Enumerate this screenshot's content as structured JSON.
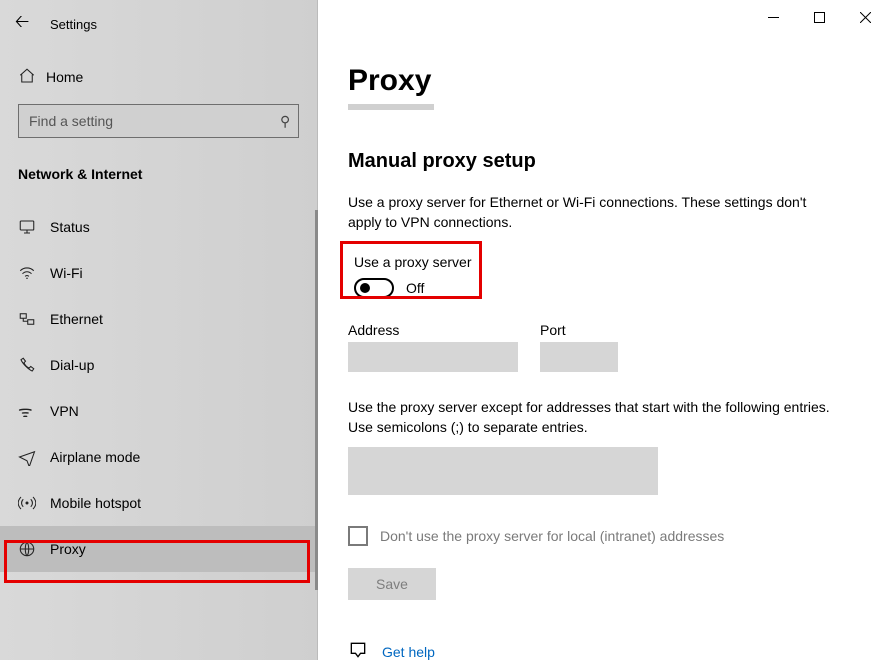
{
  "app": {
    "title": "Settings"
  },
  "sidebar": {
    "home_label": "Home",
    "search_placeholder": "Find a setting",
    "category": "Network & Internet",
    "items": [
      {
        "icon": "monitor",
        "label": "Status"
      },
      {
        "icon": "wifi",
        "label": "Wi-Fi"
      },
      {
        "icon": "ethernet",
        "label": "Ethernet"
      },
      {
        "icon": "dialup",
        "label": "Dial-up"
      },
      {
        "icon": "vpn",
        "label": "VPN"
      },
      {
        "icon": "airplane",
        "label": "Airplane mode"
      },
      {
        "icon": "hotspot",
        "label": "Mobile hotspot"
      },
      {
        "icon": "globe",
        "label": "Proxy"
      }
    ]
  },
  "page": {
    "title": "Proxy",
    "section": "Manual proxy setup",
    "description": "Use a proxy server for Ethernet or Wi-Fi connections. These settings don't apply to VPN connections.",
    "toggle_label": "Use a proxy server",
    "toggle_state": "Off",
    "address_label": "Address",
    "address_value": "",
    "port_label": "Port",
    "port_value": "",
    "entries_help": "Use the proxy server except for addresses that start with the following entries. Use semicolons (;) to separate entries.",
    "entries_value": "",
    "local_checkbox": "Don't use the proxy server for local (intranet) addresses",
    "save_label": "Save",
    "help_link": "Get help"
  }
}
